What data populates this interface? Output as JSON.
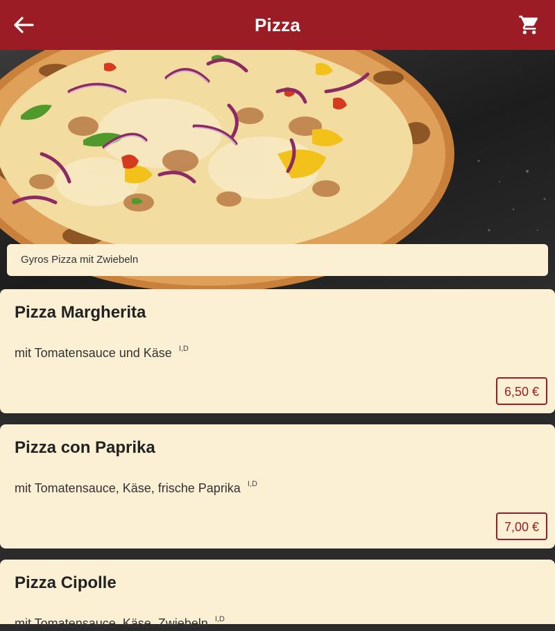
{
  "header": {
    "title": "Pizza"
  },
  "featured": {
    "caption": "Gyros Pizza mit Zwiebeln"
  },
  "menu": {
    "items": [
      {
        "name": "Pizza Margherita",
        "description": "mit Tomatensauce und Käse",
        "allergens": "I,D",
        "price": "6,50 €"
      },
      {
        "name": "Pizza con Paprika",
        "description": "mit Tomatensauce, Käse, frische Paprika",
        "allergens": "I,D",
        "price": "7,00 €"
      },
      {
        "name": "Pizza Cipolle",
        "description": "mit Tomatensauce, Käse, Zwiebeln",
        "allergens": "I,D"
      }
    ]
  },
  "theme": {
    "primary": "#9b1c24",
    "card_background": "#fbefd4",
    "page_background": "#2b2b2b"
  }
}
